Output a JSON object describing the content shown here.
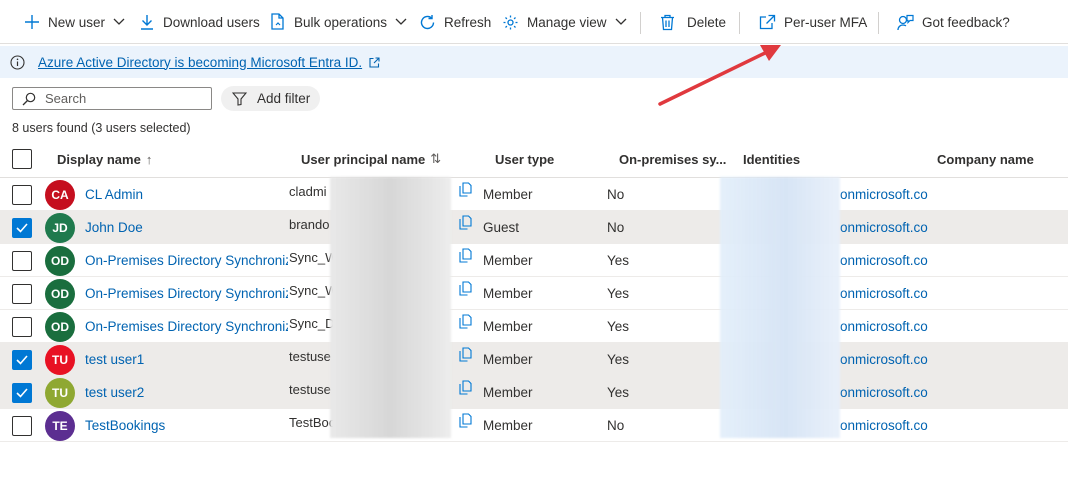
{
  "toolbar": {
    "new_user": "New user",
    "download_users": "Download users",
    "bulk_operations": "Bulk operations",
    "refresh": "Refresh",
    "manage_view": "Manage view",
    "delete": "Delete",
    "per_user_mfa": "Per-user MFA",
    "got_feedback": "Got feedback?"
  },
  "banner": {
    "text": "Azure Active Directory is becoming Microsoft Entra ID."
  },
  "search": {
    "placeholder": "Search"
  },
  "filter": {
    "label": "Add filter"
  },
  "count_text": "8 users found (3 users selected)",
  "columns": {
    "display_name": "Display name",
    "display_name_sort": "↑",
    "upn": "User principal name",
    "upn_sort": "⇅",
    "user_type": "User type",
    "on_premises": "On-premises sy...",
    "identities": "Identities",
    "company_name": "Company name"
  },
  "users": [
    {
      "initials": "CA",
      "color": "#c50f1f",
      "name": "CL Admin",
      "upn": "cladmi",
      "type": "Member",
      "onprem": "No",
      "domain": "onmicrosoft.co",
      "selected": false
    },
    {
      "initials": "JD",
      "color": "#1f7a4d",
      "name": "John Doe",
      "upn": "brando",
      "type": "Guest",
      "onprem": "No",
      "domain": "onmicrosoft.co",
      "selected": true
    },
    {
      "initials": "OD",
      "color": "#1a6e3e",
      "name": "On-Premises Directory Synchronization",
      "upn": "Sync_W",
      "type": "Member",
      "onprem": "Yes",
      "domain": "onmicrosoft.co",
      "selected": false
    },
    {
      "initials": "OD",
      "color": "#1a6e3e",
      "name": "On-Premises Directory Synchronization",
      "upn": "Sync_W",
      "type": "Member",
      "onprem": "Yes",
      "domain": "onmicrosoft.co",
      "selected": false
    },
    {
      "initials": "OD",
      "color": "#1a6e3e",
      "name": "On-Premises Directory Synchronization",
      "upn": "Sync_D",
      "type": "Member",
      "onprem": "Yes",
      "domain": "onmicrosoft.co",
      "selected": false
    },
    {
      "initials": "TU",
      "color": "#e81123",
      "name": "test user1",
      "upn": "testuse",
      "type": "Member",
      "onprem": "Yes",
      "domain": "onmicrosoft.co",
      "selected": true
    },
    {
      "initials": "TU",
      "color": "#8fa832",
      "name": "test user2",
      "upn": "testuse",
      "type": "Member",
      "onprem": "Yes",
      "domain": "onmicrosoft.co",
      "selected": true
    },
    {
      "initials": "TE",
      "color": "#5c2e91",
      "name": "TestBookings",
      "upn": "TestBoo",
      "type": "Member",
      "onprem": "No",
      "domain": "onmicrosoft.co",
      "selected": false
    }
  ],
  "colors": {
    "accent": "#0078d4",
    "link": "#0063b1",
    "banner_bg": "#ebf3fc",
    "annotation_arrow": "#e0393e"
  }
}
